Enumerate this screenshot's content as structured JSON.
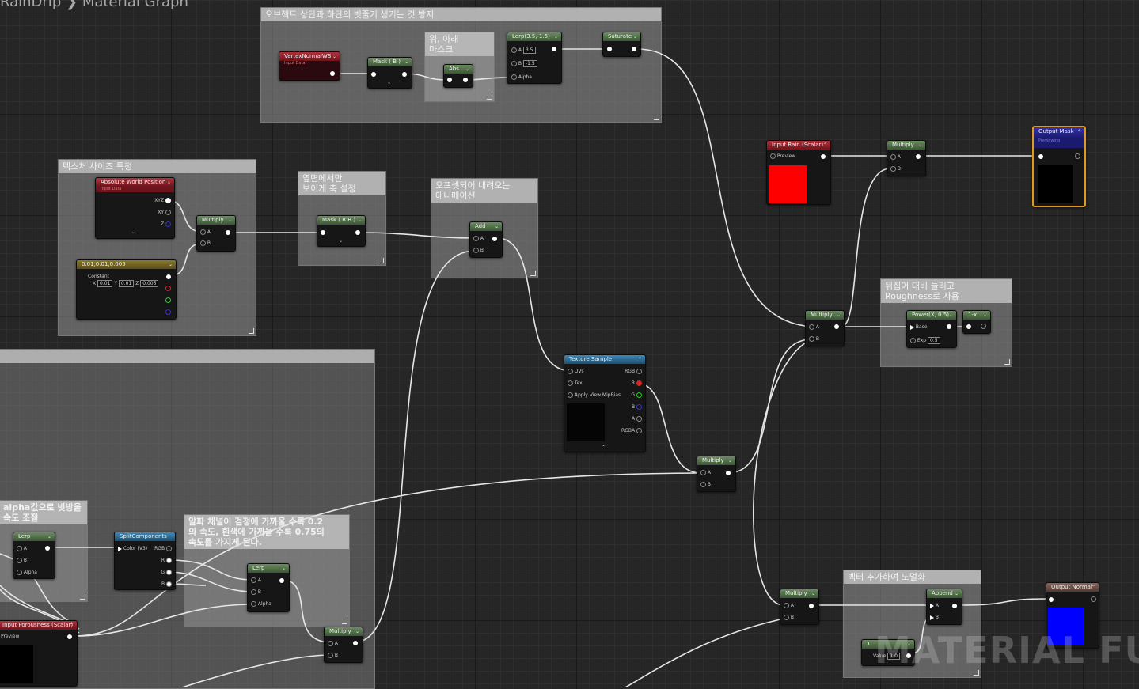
{
  "breadcrumb": {
    "asset": "RainDrip",
    "separator": "❯",
    "page": "Material Graph"
  },
  "comments": {
    "c1": "오브젝트 상단과 하단의 빗줄기 생기는 것 방지",
    "c2": "위, 아래\n마스크",
    "c3": "텍스처 사이즈 특정",
    "c4": "옆면에서만\n보이게 축 설정",
    "c5": "오프셋되어 내려오는\n애니메이션",
    "c6": "뒤집어 대비 늘리고\nRoughness로 사용",
    "c7": "alpha값으로 빗방울\n속도 조절",
    "c8": "알파 채널이 검정에 가까울 수록 0.2\n의 속도, 흰색에 가까울 수록 0.75의\n속도를 가지게 된다.",
    "c9": "벡터 추가하여 노멀화"
  },
  "nodes": {
    "vertex_normal": {
      "title": "VertexNormalWS",
      "sub": "Input Data"
    },
    "mask_b": {
      "title": "Mask ( B )"
    },
    "abs": {
      "title": "Abs"
    },
    "lerp_top": {
      "title": "Lerp(3.5,-1.5)",
      "a_label": "A",
      "a_value": "3.5",
      "b_label": "B",
      "b_value": "-1.5",
      "alpha": "Alpha"
    },
    "saturate": {
      "title": "Saturate"
    },
    "abs_world": {
      "title": "Absolute World Position",
      "sub": "Input Data",
      "p1": "XYZ",
      "p2": "XY",
      "p3": "Z"
    },
    "multiply_tex": {
      "title": "Multiply",
      "a": "A",
      "b": "B"
    },
    "const3": {
      "title": "0.01,0.01,0.005",
      "label": "Constant",
      "x_label": "X",
      "x": "0.01",
      "y_label": "Y",
      "y": "0.01",
      "z_label": "Z",
      "z": "0.005"
    },
    "mask_rb": {
      "title": "Mask ( R B )"
    },
    "add": {
      "title": "Add",
      "a": "A",
      "b": "B"
    },
    "texture_sample": {
      "title": "Texture Sample",
      "uvs": "UVs",
      "tex": "Tex",
      "bias": "Apply View MipBias",
      "rgb": "RGB",
      "r": "R",
      "g": "G",
      "b": "B",
      "a": "A",
      "rgba": "RGBA"
    },
    "input_rain": {
      "title": "Input Rain (Scalar)",
      "preview": "Preview"
    },
    "multiply_rain": {
      "title": "Multiply",
      "a": "A",
      "b": "B"
    },
    "output_mask": {
      "title": "Output Mask",
      "sub": "Previewing"
    },
    "multiply_mid": {
      "title": "Multiply",
      "a": "A",
      "b": "B"
    },
    "power": {
      "title": "Power(X, 0.5)",
      "base": "Base",
      "exp": "Exp",
      "exp_value": "0.5"
    },
    "one_minus": {
      "title": "1-x"
    },
    "multiply_tex2": {
      "title": "Multiply",
      "a": "A",
      "b": "B"
    },
    "lerp_left": {
      "title": "Lerp",
      "a": "A",
      "b": "B",
      "alpha": "Alpha"
    },
    "split": {
      "title": "SplitComponents",
      "color": "Color (V3)",
      "rgb": "RGB",
      "r": "R",
      "g": "G",
      "b": "B"
    },
    "lerp_mid": {
      "title": "Lerp",
      "a": "A",
      "b": "B",
      "alpha": "Alpha"
    },
    "input_porousness": {
      "title": "Input Porousness (Scalar)",
      "preview": "Preview"
    },
    "multiply_bottom": {
      "title": "Multiply",
      "a": "A",
      "b": "B"
    },
    "multiply_normal": {
      "title": "Multiply",
      "a": "A",
      "b": "B"
    },
    "append": {
      "title": "Append",
      "a": "A",
      "b": "B"
    },
    "const_one": {
      "title": "1",
      "label": "Value",
      "value": "1.0"
    },
    "output_normal": {
      "title": "Output Normal"
    }
  },
  "watermark": "MATERIAL FU",
  "colors": {
    "wire": "#e6e6e6",
    "rain_preview": "#ff0000",
    "normal_preview": "#0000ff"
  }
}
